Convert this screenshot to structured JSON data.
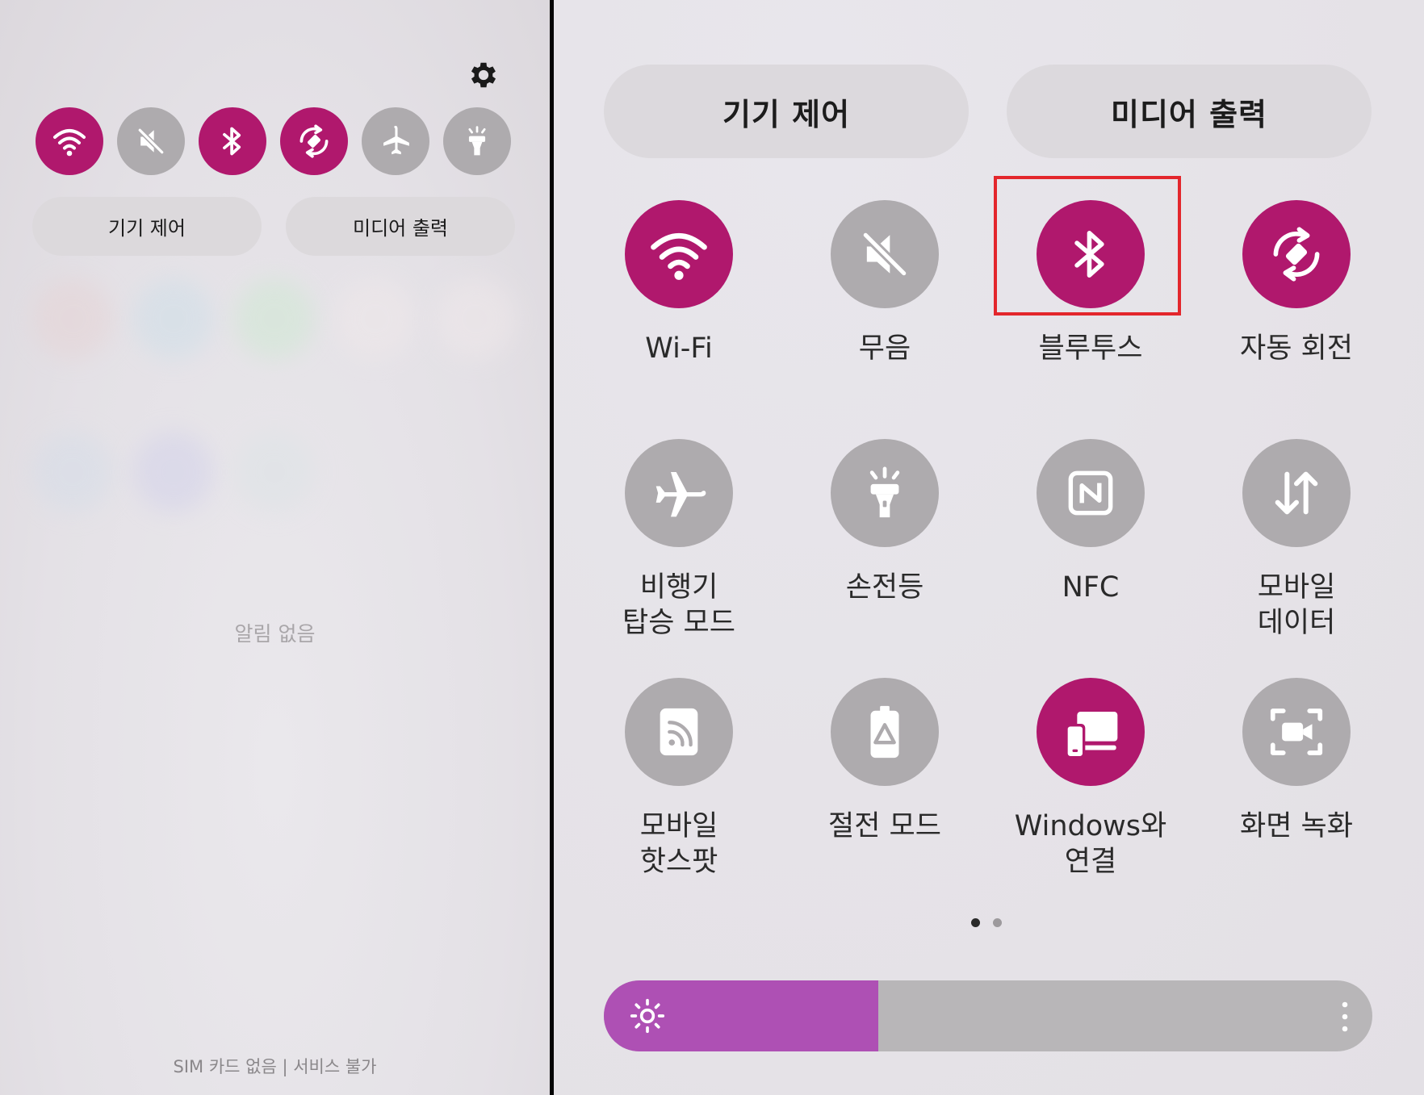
{
  "left_panel": {
    "toggles": [
      {
        "name": "wifi-icon",
        "state": "on"
      },
      {
        "name": "mute-icon",
        "state": "off"
      },
      {
        "name": "bluetooth-icon",
        "state": "on"
      },
      {
        "name": "auto-rotate-icon",
        "state": "on"
      },
      {
        "name": "airplane-icon",
        "state": "off"
      },
      {
        "name": "flashlight-icon",
        "state": "off"
      }
    ],
    "device_control_label": "기기 제어",
    "media_output_label": "미디어 출력",
    "no_notifications": "알림 없음",
    "status_text": "SIM 카드 없음 | 서비스 불가"
  },
  "right_panel": {
    "tabs": {
      "device_control": "기기 제어",
      "media_output": "미디어 출력"
    },
    "tiles": [
      {
        "label": "Wi-Fi",
        "icon": "wifi-icon",
        "state": "on"
      },
      {
        "label": "무음",
        "icon": "mute-icon",
        "state": "off"
      },
      {
        "label": "블루투스",
        "icon": "bluetooth-icon",
        "state": "on"
      },
      {
        "label": "자동 회전",
        "icon": "auto-rotate-icon",
        "state": "on"
      },
      {
        "label": "비행기\n탑승 모드",
        "icon": "airplane-icon",
        "state": "off"
      },
      {
        "label": "손전등",
        "icon": "flashlight-icon",
        "state": "off"
      },
      {
        "label": "NFC",
        "icon": "nfc-icon",
        "state": "off"
      },
      {
        "label": "모바일\n데이터",
        "icon": "mobile-data-icon",
        "state": "off"
      },
      {
        "label": "모바일\n핫스팟",
        "icon": "hotspot-icon",
        "state": "off"
      },
      {
        "label": "절전 모드",
        "icon": "power-saving-icon",
        "state": "off"
      },
      {
        "label": "Windows와\n연결",
        "icon": "link-to-windows-icon",
        "state": "on"
      },
      {
        "label": "화면 녹화",
        "icon": "screen-recorder-icon",
        "state": "off"
      }
    ],
    "page_indicator": {
      "current": 1,
      "total": 2
    },
    "brightness_level": 0.357
  },
  "colors": {
    "accent_on": "#b0186d",
    "tile_off": "#aeabae",
    "brightness_fill": "#ae50b4",
    "highlight_box": "#e3262c"
  }
}
